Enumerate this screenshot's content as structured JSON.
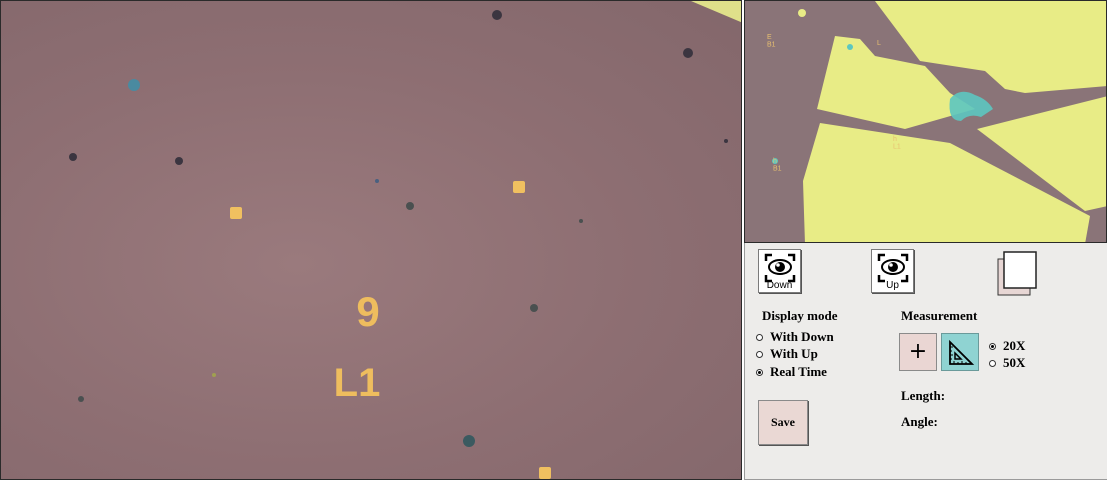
{
  "live_view": {
    "markers": [
      "9",
      "L1"
    ]
  },
  "preview": {
    "markers": [
      "E\nB1",
      "h\nB1",
      "h\nL1",
      "L"
    ]
  },
  "camera_buttons": {
    "down": {
      "label": "Down",
      "icon": "camera-eye-icon"
    },
    "up": {
      "label": "Up",
      "icon": "camera-eye-icon"
    },
    "layers": {
      "icon": "layers-icon"
    }
  },
  "display_mode": {
    "title": "Display mode",
    "options": [
      "With Down",
      "With Up",
      "Real Time"
    ],
    "selected": "Real Time"
  },
  "measurement": {
    "title": "Measurement",
    "tools": [
      {
        "icon": "crosshair-icon",
        "glyph": "+"
      },
      {
        "icon": "ruler-triangle-icon"
      }
    ],
    "magnification_options": [
      "20X",
      "50X"
    ],
    "selected_magnification": "20X",
    "length_label": "Length:",
    "angle_label": "Angle:"
  },
  "save_label": "Save",
  "colors": {
    "substrate": "#8d6e72",
    "gold_pad": "#d8dc7a",
    "marker": "#f0c060",
    "panel_bg": "#edecea",
    "ruler_button": "#8fd3d2",
    "cross_button": "#ead6d3"
  }
}
